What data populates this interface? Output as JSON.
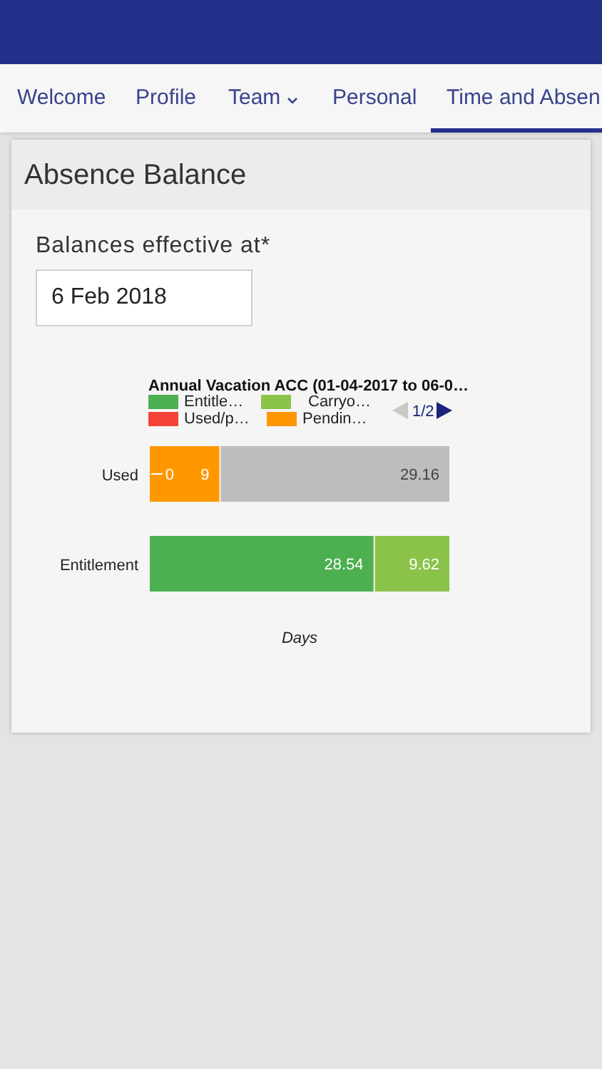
{
  "nav": {
    "tabs": [
      {
        "label": "Welcome",
        "selected": false
      },
      {
        "label": "Profile",
        "selected": false
      },
      {
        "label": "Team",
        "selected": false,
        "dropdown": true
      },
      {
        "label": "Personal",
        "selected": false
      },
      {
        "label": "Time and Absen",
        "selected": true
      }
    ]
  },
  "card": {
    "title": "Absence Balance",
    "field": {
      "label": "Balances effective at*",
      "value": "6 Feb 2018"
    },
    "chart": {
      "legend_pager": "1/2",
      "chart_data": {
        "type": "bar",
        "orientation": "horizontal",
        "stacked": true,
        "legend": true,
        "data_labels": true,
        "title": "Annual Vacation ACC (01-04-2017 to 06-0…",
        "xlabel": "Days",
        "categories": [
          "Used",
          "Entitlement"
        ],
        "series": [
          {
            "name": "Entitle…",
            "color": "#4caf50",
            "values": [
              null,
              28.54
            ]
          },
          {
            "name": "Carryo…",
            "color": "#8bc34a",
            "values": [
              null,
              9.62
            ]
          },
          {
            "name": "Used/p…",
            "color": "#f44336",
            "values": [
              0,
              null
            ]
          },
          {
            "name": "Pendin…",
            "color": "#ff9800",
            "values": [
              9,
              null
            ]
          },
          {
            "color": "#bdbdbd",
            "values": [
              29.16,
              null
            ]
          }
        ]
      }
    }
  }
}
